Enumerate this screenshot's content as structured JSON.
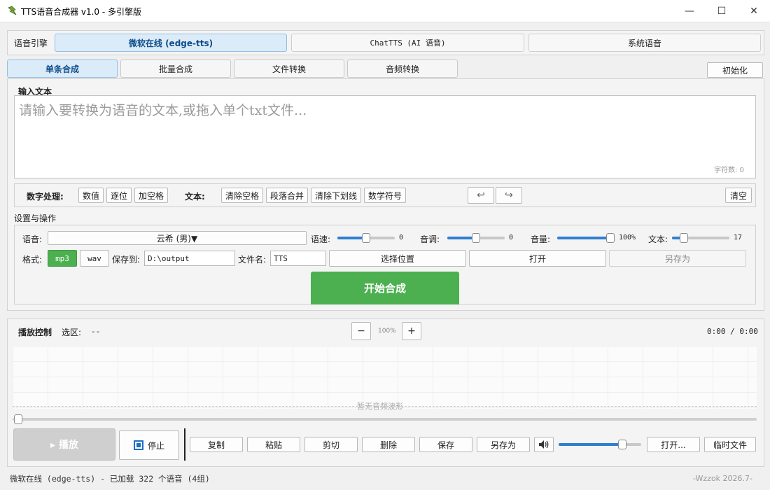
{
  "window": {
    "title": "TTS语音合成器 v1.0 - 多引擎版",
    "minimize_glyph": "—",
    "maximize_glyph": "☐",
    "close_glyph": "✕"
  },
  "engine": {
    "label": "语音引擎",
    "tabs": [
      "微软在线 (edge-tts)",
      "ChatTTS (AI 语音)",
      "系统语音"
    ],
    "active_index": 0
  },
  "modes": {
    "tabs": [
      "单条合成",
      "批量合成",
      "文件转换",
      "音频转换"
    ],
    "active_index": 0,
    "init_button": "初始化"
  },
  "input": {
    "title": "输入文本",
    "placeholder": "请输入要转换为语音的文本,或拖入单个txt文件...",
    "char_count": "字符数: 0"
  },
  "toolbar": {
    "number_label": "数字处理:",
    "number_buttons": [
      "数值",
      "逐位",
      "加空格"
    ],
    "text_label": "文本:",
    "text_buttons": [
      "清除空格",
      "段落合并",
      "清除下划线",
      "数学符号"
    ],
    "undo_glyph": "↩",
    "redo_glyph": "↪",
    "clear_button": "清空"
  },
  "settings": {
    "title": "设置与操作",
    "voice_label": "语音:",
    "voice_value": "云希 (男)▼",
    "speed_label": "语速:",
    "speed_value": "0",
    "speed_level": 0.5,
    "pitch_label": "音调:",
    "pitch_value": "0",
    "pitch_level": 0.5,
    "volume_label": "音量:",
    "volume_value": "100%",
    "volume_level": 1.0,
    "text_label": "文本:",
    "text_value": "17",
    "text_level": 0.15,
    "format_label": "格式:",
    "format_options": [
      "mp3",
      "wav"
    ],
    "format_selected": "mp3",
    "save_to_label": "保存到:",
    "save_to_value": "D:\\output",
    "filename_label": "文件名:",
    "filename_value": "TTS",
    "choose_location": "选择位置",
    "open": "打开",
    "save_as": "另存为",
    "start": "开始合成"
  },
  "playback": {
    "title": "播放控制",
    "selection_label": "选区:",
    "selection_value": "--",
    "zoom_out": "−",
    "zoom_value": "100%",
    "zoom_in": "+",
    "time": "0:00 / 0:00",
    "waveform_empty": "暂无音频波形",
    "play": "▸ 播放",
    "stop": "停止",
    "actions": [
      "复制",
      "粘贴",
      "剪切",
      "删除",
      "保存",
      "另存为"
    ],
    "volume_level": 0.8,
    "open_button": "打开...",
    "temp_file_button": "临时文件"
  },
  "status": {
    "text": "微软在线 (edge-tts) - 已加载 322 个语音 (4组)",
    "author": "-Wzzok 2026.7-"
  },
  "colors": {
    "accent_green": "#4caf50",
    "accent_blue": "#2f7fd1",
    "active_tab_bg": "#dcebf8"
  }
}
